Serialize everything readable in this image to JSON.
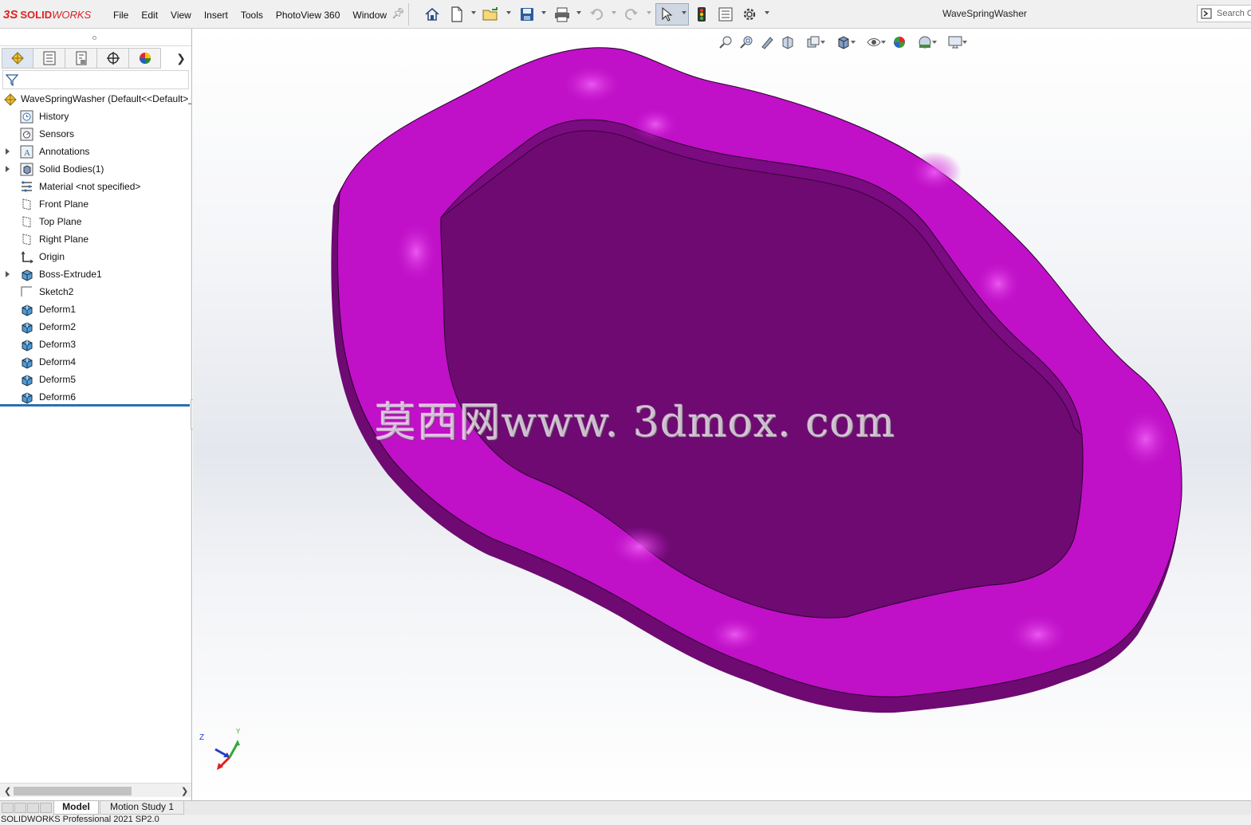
{
  "app": {
    "logo_prefix": "3S",
    "logo_solid": "SOLID",
    "logo_works": "WORKS"
  },
  "menu": [
    "File",
    "Edit",
    "View",
    "Insert",
    "Tools",
    "PhotoView 360",
    "Window"
  ],
  "document_title": "WaveSpringWasher",
  "search": {
    "label": "Search C"
  },
  "tree": {
    "root": "WaveSpringWasher  (Default<<Default>_",
    "items": [
      {
        "label": "History",
        "icon": "history-icon",
        "expandable": false
      },
      {
        "label": "Sensors",
        "icon": "sensors-icon",
        "expandable": false
      },
      {
        "label": "Annotations",
        "icon": "annotations-icon",
        "expandable": true
      },
      {
        "label": "Solid Bodies(1)",
        "icon": "solid-bodies-icon",
        "expandable": true
      },
      {
        "label": "Material <not specified>",
        "icon": "material-icon",
        "expandable": false
      },
      {
        "label": "Front Plane",
        "icon": "plane-icon",
        "expandable": false
      },
      {
        "label": "Top Plane",
        "icon": "plane-icon",
        "expandable": false
      },
      {
        "label": "Right Plane",
        "icon": "plane-icon",
        "expandable": false
      },
      {
        "label": "Origin",
        "icon": "origin-icon",
        "expandable": false
      },
      {
        "label": "Boss-Extrude1",
        "icon": "extrude-icon",
        "expandable": true
      },
      {
        "label": "Sketch2",
        "icon": "sketch-icon",
        "expandable": false
      },
      {
        "label": "Deform1",
        "icon": "deform-icon",
        "expandable": false
      },
      {
        "label": "Deform2",
        "icon": "deform-icon",
        "expandable": false
      },
      {
        "label": "Deform3",
        "icon": "deform-icon",
        "expandable": false
      },
      {
        "label": "Deform4",
        "icon": "deform-icon",
        "expandable": false
      },
      {
        "label": "Deform5",
        "icon": "deform-icon",
        "expandable": false
      },
      {
        "label": "Deform6",
        "icon": "deform-icon",
        "expandable": false
      }
    ]
  },
  "watermark": "莫西网www. 3dmox. com",
  "triad": {
    "z_label": "Z",
    "y_label": "Y"
  },
  "bottom_tabs": {
    "model": "Model",
    "motion": "Motion Study 1"
  },
  "status": "SOLIDWORKS Professional 2021 SP2.0",
  "colors": {
    "part": "#c010c8",
    "part_dark": "#6e0a72",
    "accent": "#2e6fb1",
    "brand": "#d22222"
  }
}
